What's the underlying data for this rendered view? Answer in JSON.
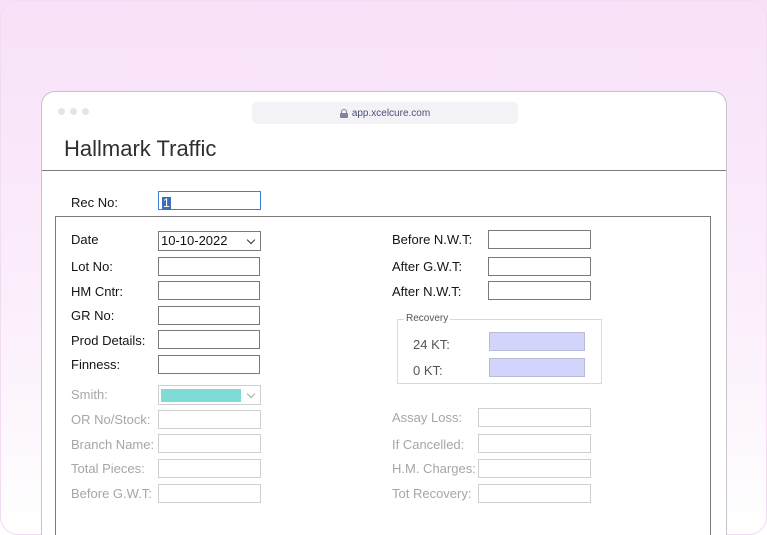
{
  "browser": {
    "url": "app.xcelcure.com"
  },
  "app": {
    "title": "Hallmark Traffic"
  },
  "rec": {
    "label": "Rec No:",
    "value": "1"
  },
  "left": {
    "date_label": "Date",
    "date_value": "10-10-2022",
    "lot_label": "Lot No:",
    "hm_label": "HM Cntr:",
    "gr_label": "GR No:",
    "prod_label": "Prod Details:",
    "finness_label": "Finness:",
    "smith_label": "Smith:",
    "or_label": "OR No/Stock:",
    "branch_label": "Branch Name:",
    "pieces_label": "Total Pieces:",
    "bgwt_label": "Before G.W.T:"
  },
  "right": {
    "bnwt_label": "Before N.W.T:",
    "agwt_label": "After G.W.T:",
    "anwt_label": "After N.W.T:",
    "recovery_title": "Recovery",
    "kt24_label": "24 KT:",
    "kt0_label": "0 KT:",
    "assay_label": "Assay Loss:",
    "cancel_label": "If Cancelled:",
    "hmc_label": "H.M. Charges:",
    "totrec_label": "Tot Recovery:"
  },
  "colors": {
    "accent_selection": "#3d6fb8",
    "smith_fill": "#7fdbd6",
    "recovery_fill": "#d2d4fb"
  }
}
